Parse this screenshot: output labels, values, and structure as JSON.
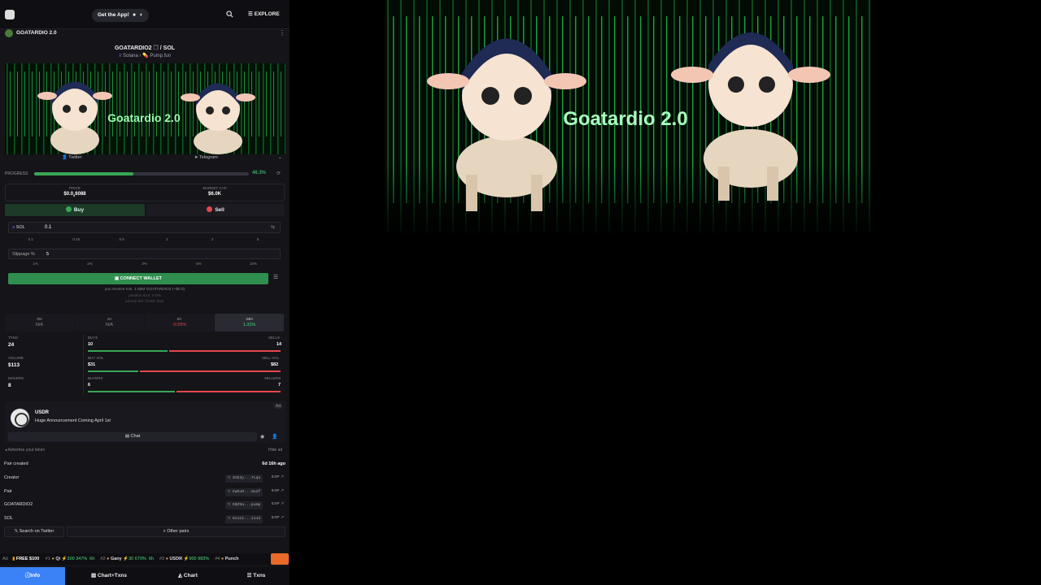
{
  "topbar": {
    "get_app": "Get the App!",
    "explore": "EXPLORE"
  },
  "token": {
    "name_header": "GOATARDIO 2.0",
    "pair_base": "GOATARDIO2",
    "pair_quote": "SOL",
    "chain": "Solana",
    "dex": "Pump.fun",
    "banner_text": "Goatardio 2.0"
  },
  "socials": {
    "twitter": "Twitter",
    "telegram": "Telegram"
  },
  "progress": {
    "label": "PROGRESS",
    "value_pct": 46.3,
    "display": "46.3%"
  },
  "stats": {
    "price_label": "PRICE",
    "price_value": "$0.0",
    "price_sub": "5",
    "price_tail": "6088",
    "mcap_label": "MARKET CAP",
    "mcap_value": "$6.0K"
  },
  "trade": {
    "buy": "Buy",
    "sell": "Sell",
    "currency": "SOL",
    "amount": "0.1",
    "quick": [
      "0.1",
      "0.25",
      "0.5",
      "1",
      "2",
      "5"
    ],
    "slippage_label": "Slippage %",
    "slippage_value": "5",
    "slip_quick": [
      "1%",
      "2%",
      "3%",
      "5%",
      "10%"
    ],
    "connect": "CONNECT WALLET",
    "receive": "you receive min. 1.65M GOATARDIO2 (~$0.0)",
    "position": "position size: 0.0%",
    "priority": "priority fee: 0.001 SOL"
  },
  "timeframes": [
    {
      "name": "5M",
      "value": "N/A"
    },
    {
      "name": "1H",
      "value": "N/A"
    },
    {
      "name": "6H",
      "value": "-0.59%"
    },
    {
      "name": "24H",
      "value": "1.31%"
    }
  ],
  "txstats": {
    "txns_label": "TXNS",
    "txns": "24",
    "volume_label": "VOLUME",
    "volume": "$113",
    "makers_label": "MAKERS",
    "makers": "8",
    "buys_label": "BUYS",
    "buys": "10",
    "sells_label": "SELLS",
    "sells": "14",
    "buyvol_label": "BUY VOL",
    "buyvol": "$31",
    "sellvol_label": "SELL VOL",
    "sellvol": "$82",
    "buyers_label": "BUYERS",
    "buyers": "6",
    "sellers_label": "SELLERS",
    "sellers": "7",
    "buys_frac": 0.42,
    "vol_frac": 0.27,
    "buyers_frac": 0.46
  },
  "ad": {
    "badge": "Ad",
    "title": "USDR",
    "subtitle": "Huge Announcement Coming April 1st",
    "chat": "Chat",
    "advertise": "Advertise your token",
    "hide": "Hide ad"
  },
  "pairinfo": {
    "created_label": "Pair created",
    "created_value": "6d 16h ago",
    "rows": [
      {
        "label": "Creator",
        "addr": "3AE3y...7Lqu",
        "exp": "EXP"
      },
      {
        "label": "Pair",
        "addr": "CwEuM...mu2f",
        "exp": "EXP"
      },
      {
        "label": "GOATARDIO2",
        "addr": "GNZ5a...pump",
        "exp": "EXP"
      },
      {
        "label": "SOL",
        "addr": "So111...1112",
        "exp": "EXP"
      }
    ],
    "search_twitter": "Search on Twitter",
    "other_pairs": "Other pairs"
  },
  "ticker": {
    "ad": "Ad",
    "free": "FREE $100",
    "items": [
      {
        "rank": "#1",
        "name": "Qi",
        "pct": "300 347%",
        "age": "6h"
      },
      {
        "rank": "#2",
        "name": "Gany",
        "pct": "30 670%",
        "age": "6h"
      },
      {
        "rank": "#3",
        "name": "USDR",
        "pct": "900 983%",
        "age": ""
      },
      {
        "rank": "#4",
        "name": "Punch",
        "pct": "",
        "age": ""
      }
    ]
  },
  "bottomnav": {
    "info": "Info",
    "chart_txns": "Chart+Txns",
    "chart": "Chart",
    "txns": "Txns"
  },
  "colors": {
    "accent": "#3b82f6",
    "buy": "#3aa655",
    "sell": "#e5484d",
    "positive": "#4ade80"
  }
}
